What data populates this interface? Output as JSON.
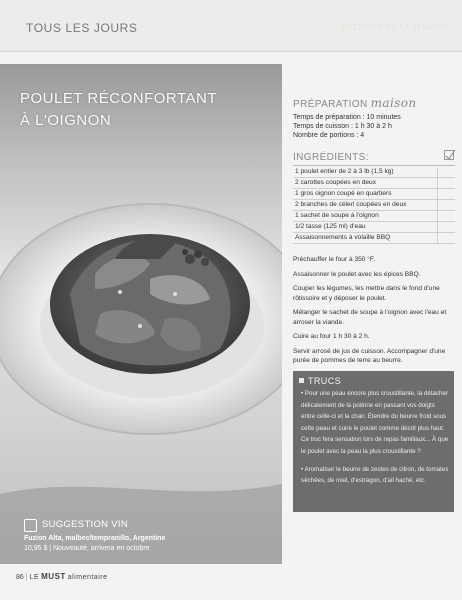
{
  "header": {
    "section": "TOUS LES JOURS",
    "ghost": "RECETTES DE LA SEMAINE"
  },
  "recipe": {
    "title_line1": "POULET RÉCONFORTANT",
    "title_line2": "À L'OIGNON"
  },
  "preparation": {
    "label": "PRÉPARATION",
    "script": "maison",
    "lines": [
      "Temps de préparation : 10 minutes",
      "Temps de cuisson : 1 h 30 à 2 h",
      "Nombre de portions : 4"
    ]
  },
  "ingredients": {
    "label": "INGRÉDIENTS:",
    "items": [
      "1 poulet entier de 2 à 3 lb (1,5 kg)",
      "2 carottes coupées en deux",
      "1 gros oignon coupé en quartiers",
      "2 branches de céleri coupées en deux",
      "1 sachet de soupe à l'oignon",
      "1/2 tasse (125 ml) d'eau",
      "Assaisonnements à volaille BBQ"
    ]
  },
  "steps": [
    "Préchauffer le four à 350 °F.",
    "Assaisonner le poulet avec les épices BBQ.",
    "Couper les légumes, les mettre dans le fond d'une rôtissoire et y déposer le poulet.",
    "Mélanger le sachet de soupe à l'oignon avec l'eau et arroser la viande.",
    "Cuire au four 1 h 30 à 2 h.",
    "Servir arrosé de jus de cuisson. Accompagner d'une purée de pommes de terre au beurre."
  ],
  "tips": {
    "label": "TRUCS",
    "items": [
      "• Pour une peau encore plus croustillante, la détacher délicatement de la poitrine en passant vos doigts entre celle-ci et la chair. Étendre du beurre froid sous cette peau et cuire le poulet comme décrit plus haut. Ce truc fera sensation lors de repas familiaux... À que le poulet avec la peau la plus croustillante ?",
      "• Aromatiser le beurre de zestes de citron, de tomates séchées, de miel, d'estragon, d'ail haché, etc."
    ]
  },
  "wine": {
    "label": "SUGGESTION VIN",
    "line1": "Fuzion Alta, malbec/tempranillo, Argentine",
    "line2": "10,95 $ | Nouveauté, arrivera en octobre"
  },
  "footer": {
    "page": "86",
    "magazine_a": "LE",
    "magazine_b": "MUST",
    "magazine_c": "alimentaire"
  }
}
